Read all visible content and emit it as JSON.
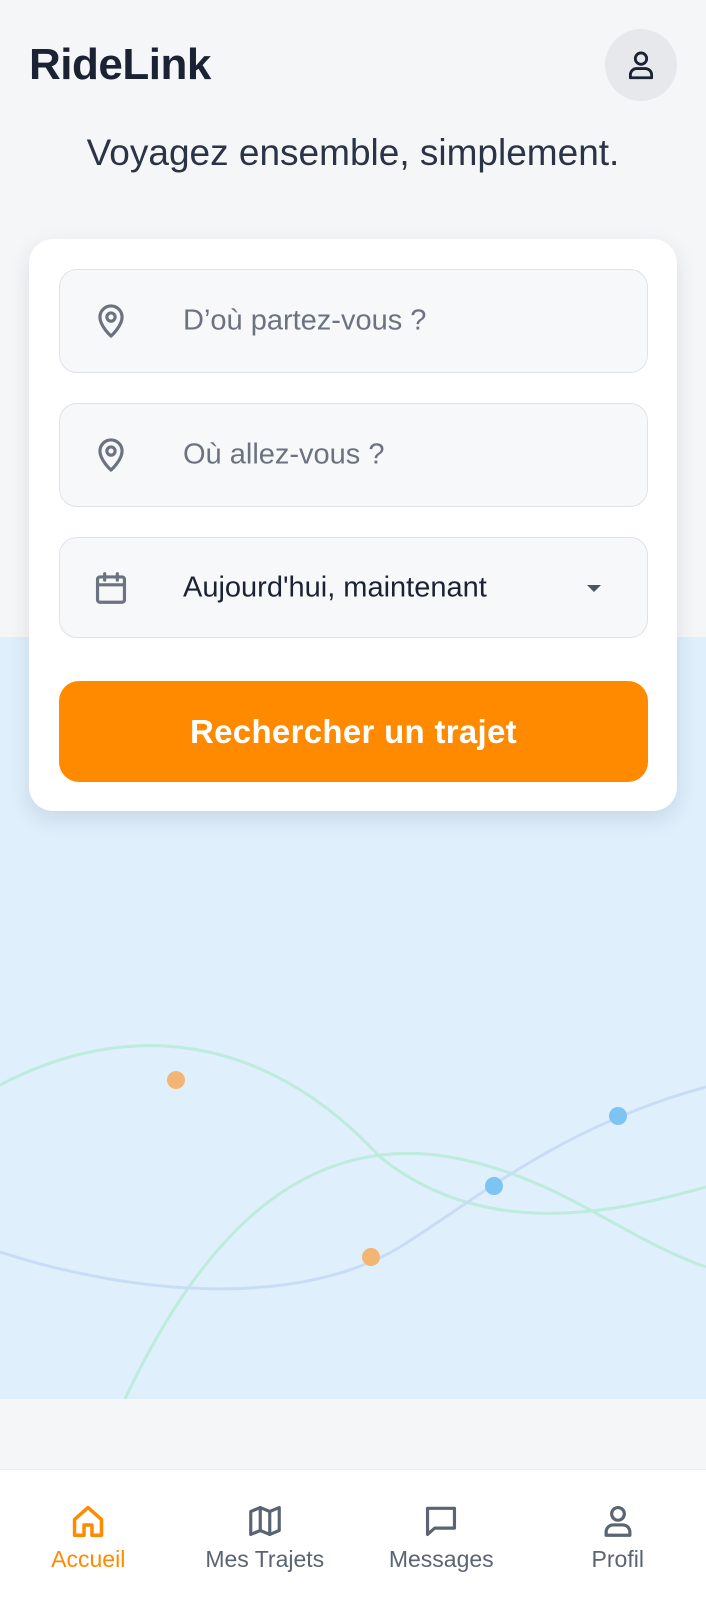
{
  "app": {
    "title": "RideLink"
  },
  "header": {
    "tagline": "Voyagez ensemble, simplement."
  },
  "search": {
    "from_placeholder": "D’où partez-vous ?",
    "to_placeholder": "Où allez-vous ?",
    "date_value": "Aujourd'hui, maintenant",
    "button_label": "Rechercher un trajet"
  },
  "nav": {
    "items": [
      {
        "label": "Accueil",
        "icon": "home-icon",
        "active": true
      },
      {
        "label": "Mes Trajets",
        "icon": "map-icon",
        "active": false
      },
      {
        "label": "Messages",
        "icon": "chat-icon",
        "active": false
      },
      {
        "label": "Profil",
        "icon": "user-icon",
        "active": false
      }
    ]
  },
  "colors": {
    "accent": "#ff8a00",
    "brand_text": "#1a2233",
    "map_background": "#dfeffc",
    "route_green": "#bdebdc",
    "route_blue": "#c9dcf7",
    "marker_orange": "#f2b574",
    "marker_blue": "#7cc4f2"
  }
}
